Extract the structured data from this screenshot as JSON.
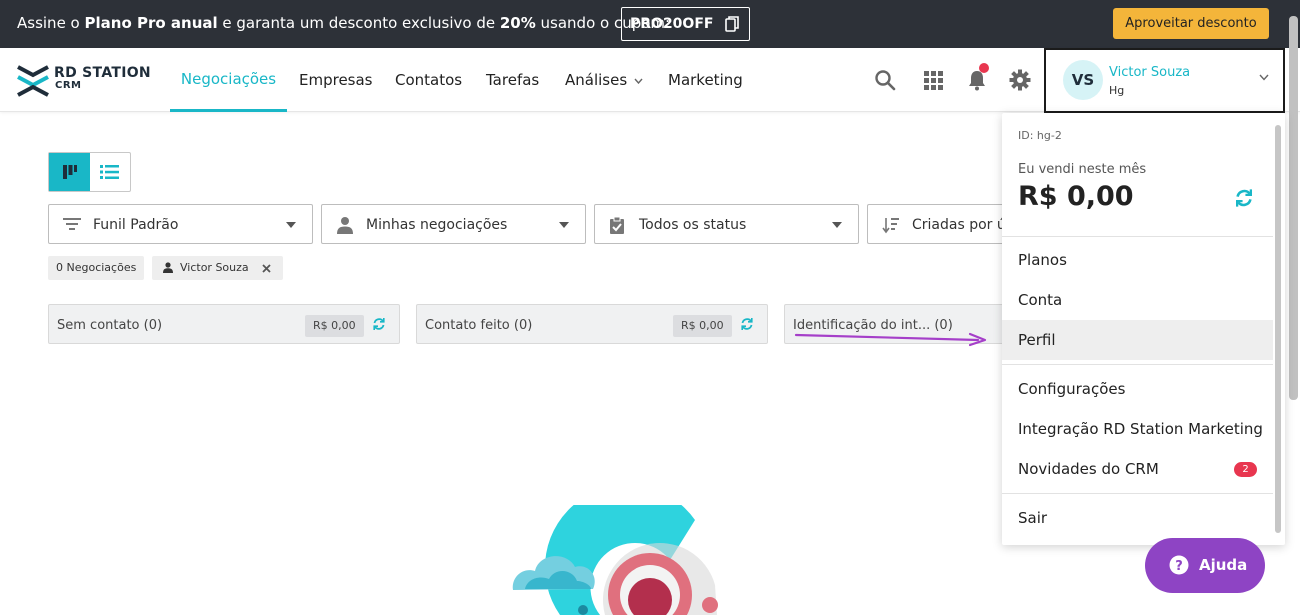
{
  "promo": {
    "prefix": "Assine o ",
    "plan": "Plano Pro anual",
    "middle": " e garanta um desconto exclusivo de ",
    "discount": "20%",
    "suffix": " usando o cupom:",
    "coupon": "PRO20OFF",
    "cta": "Aproveitar desconto",
    "copy_icon": "copy-icon"
  },
  "logo": {
    "line1": "RD STATION",
    "line2": "CRM"
  },
  "nav": {
    "items": [
      "Negociações",
      "Empresas",
      "Contatos",
      "Tarefas",
      "Análises",
      "Marketing"
    ],
    "active": "Negociações",
    "icons": [
      "search-icon",
      "apps-grid-icon",
      "bell-icon",
      "gear-icon"
    ]
  },
  "user": {
    "initials": "VS",
    "name": "Victor Souza",
    "sub": "Hg"
  },
  "filters": {
    "funnel": "Funil Padrão",
    "owner": "Minhas negociações",
    "status": "Todos os status",
    "sort": "Criadas por ú"
  },
  "tags": {
    "count": "0 Negociações",
    "owner": "Victor Souza"
  },
  "stages": [
    {
      "title": "Sem contato (0)",
      "amount": "R$ 0,00"
    },
    {
      "title": "Contato feito (0)",
      "amount": "R$ 0,00"
    },
    {
      "title": "Identificação do int...  (0)",
      "amount": ""
    }
  ],
  "dropdown": {
    "id_label": "ID: hg-2",
    "sold_label": "Eu vendi neste mês",
    "sold_value": "R$ 0,00",
    "items": [
      "Planos",
      "Conta",
      "Perfil",
      "Configurações",
      "Integração RD Station Marketing",
      "Novidades do CRM",
      "Sair"
    ],
    "hovered": "Perfil",
    "badge": "2"
  },
  "help": {
    "label": "Ajuda"
  },
  "colors": {
    "accent": "#19b7c7",
    "banner": "#2d3138",
    "promo_button": "#f4b53a",
    "help": "#8e44c4",
    "alert": "#e8364f"
  }
}
